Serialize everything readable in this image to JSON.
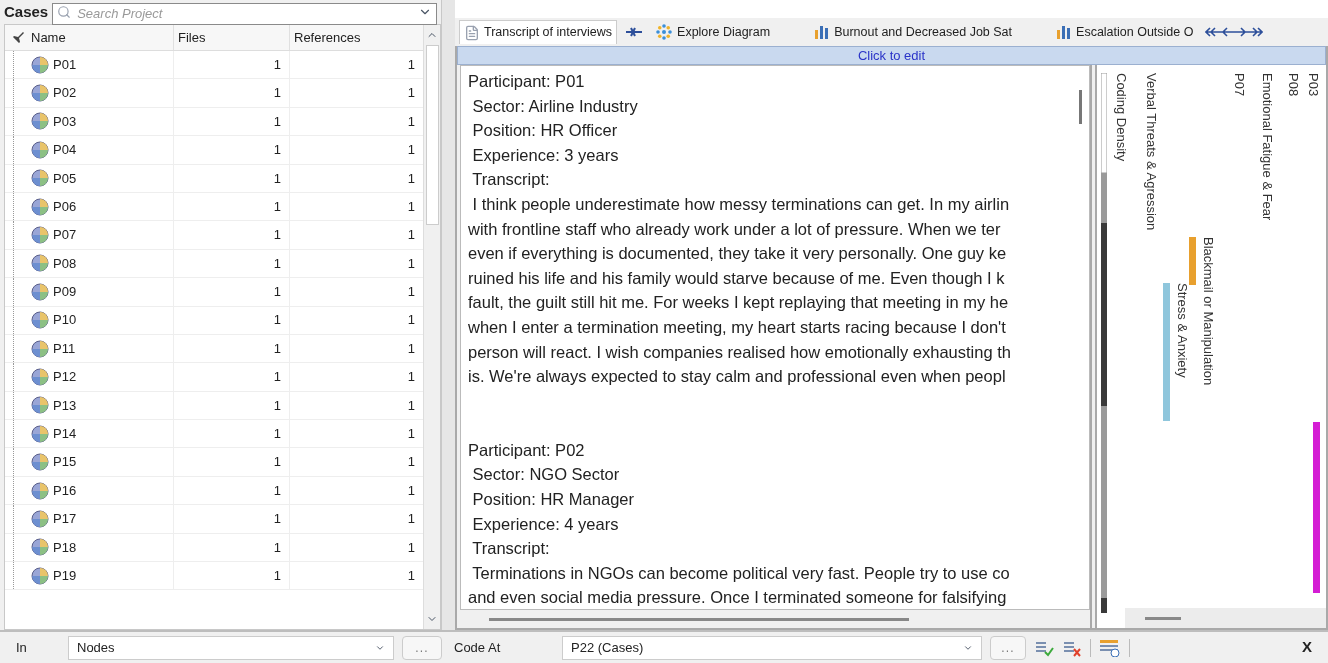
{
  "cases_panel": {
    "title": "Cases",
    "search": {
      "placeholder": "Search Project"
    },
    "columns": [
      "Name",
      "Files",
      "References"
    ],
    "rows": [
      {
        "name": "P01",
        "files": "1",
        "references": "1"
      },
      {
        "name": "P02",
        "files": "1",
        "references": "1"
      },
      {
        "name": "P03",
        "files": "1",
        "references": "1"
      },
      {
        "name": "P04",
        "files": "1",
        "references": "1"
      },
      {
        "name": "P05",
        "files": "1",
        "references": "1"
      },
      {
        "name": "P06",
        "files": "1",
        "references": "1"
      },
      {
        "name": "P07",
        "files": "1",
        "references": "1"
      },
      {
        "name": "P08",
        "files": "1",
        "references": "1"
      },
      {
        "name": "P09",
        "files": "1",
        "references": "1"
      },
      {
        "name": "P10",
        "files": "1",
        "references": "1"
      },
      {
        "name": "P11",
        "files": "1",
        "references": "1"
      },
      {
        "name": "P12",
        "files": "1",
        "references": "1"
      },
      {
        "name": "P13",
        "files": "1",
        "references": "1"
      },
      {
        "name": "P14",
        "files": "1",
        "references": "1"
      },
      {
        "name": "P15",
        "files": "1",
        "references": "1"
      },
      {
        "name": "P16",
        "files": "1",
        "references": "1"
      },
      {
        "name": "P17",
        "files": "1",
        "references": "1"
      },
      {
        "name": "P18",
        "files": "1",
        "references": "1"
      },
      {
        "name": "P19",
        "files": "1",
        "references": "1"
      }
    ]
  },
  "tabs": [
    {
      "label": "Transcript of interviews",
      "kind": "document",
      "selected": true
    },
    {
      "label": "Explore Diagram",
      "kind": "diagram",
      "selected": false
    },
    {
      "label": "Burnout and Decreased Job Sat",
      "kind": "chart",
      "selected": false
    },
    {
      "label": "Escalation Outside O",
      "kind": "chart",
      "selected": false
    }
  ],
  "click_to_edit": "Click to edit",
  "transcript": {
    "paragraphs": [
      [
        "Participant: P01",
        " Sector: Airline Industry",
        " Position: HR Officer",
        " Experience: 3 years",
        " Transcript:",
        " I think people underestimate how messy terminations can get. In my airlin",
        "with frontline staff who already work under a lot of pressure. When we ter",
        "even if everything is documented, they take it very personally. One guy ke",
        "ruined his life and his family would starve because of me. Even though I k",
        "fault, the guilt still hit me. For weeks I kept replaying that meeting in my he",
        "when I enter a termination meeting, my heart starts racing because I don't",
        "person will react. I wish companies realised how emotionally exhausting th",
        "is. We're always expected to stay calm and professional even when peopl"
      ],
      [
        "Participant: P02",
        " Sector: NGO Sector",
        " Position: HR Manager",
        " Experience: 4 years",
        " Transcript:",
        " Terminations in NGOs can become political very fast. People try to use co",
        "and even social media pressure. Once I terminated someone for falsifying"
      ]
    ]
  },
  "coding_stripes": [
    {
      "label": "Coding Density",
      "kind": "density"
    },
    {
      "label": "Verbal Threats & Agression",
      "kind": "label"
    },
    {
      "label": "Stress & Anxiety",
      "kind": "bar",
      "color": "#8fc6dc"
    },
    {
      "label": "Blackmail or Manipulation",
      "kind": "bar",
      "color": "#e8a02e"
    },
    {
      "label": "P07",
      "kind": "label"
    },
    {
      "label": "Emotional Fatigue & Fear",
      "kind": "label"
    },
    {
      "label": "P08",
      "kind": "label"
    },
    {
      "label": "P03",
      "kind": "label"
    },
    {
      "kind": "bar",
      "color": "#d41ed4"
    }
  ],
  "bottom_bar": {
    "in_label": "In",
    "in_value": "Nodes",
    "browse": "...",
    "code_at_label": "Code At",
    "code_at_value": "P22 (Cases)",
    "browse_2": "...",
    "close": "X"
  }
}
